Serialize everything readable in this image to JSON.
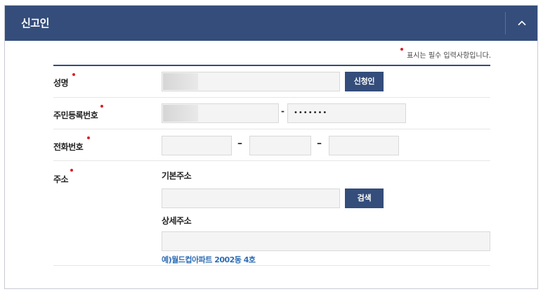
{
  "header": {
    "title": "신고인",
    "toggle_icon": "chevron-up-icon"
  },
  "required_note": "표시는 필수 입력사항입니다.",
  "fields": {
    "name": {
      "label": "성명",
      "value": "",
      "button": "신청인"
    },
    "rrn": {
      "label": "주민등록번호",
      "front_value": "",
      "separator": "-",
      "back_value": "•••••••"
    },
    "phone": {
      "label": "전화번호",
      "separator1": "–",
      "separator2": "–",
      "part1": "",
      "part2": "",
      "part3": ""
    },
    "address": {
      "label": "주소",
      "basic_label": "기본주소",
      "basic_value": "",
      "search_button": "검색",
      "detail_label": "상세주소",
      "detail_value": "",
      "example": "예)월드컵아파트 2002동 4호"
    }
  },
  "colors": {
    "header_bg": "#344d7a",
    "button_bg": "#344d7a",
    "required_dot": "#d8202a",
    "example_text": "#2e6db5"
  }
}
